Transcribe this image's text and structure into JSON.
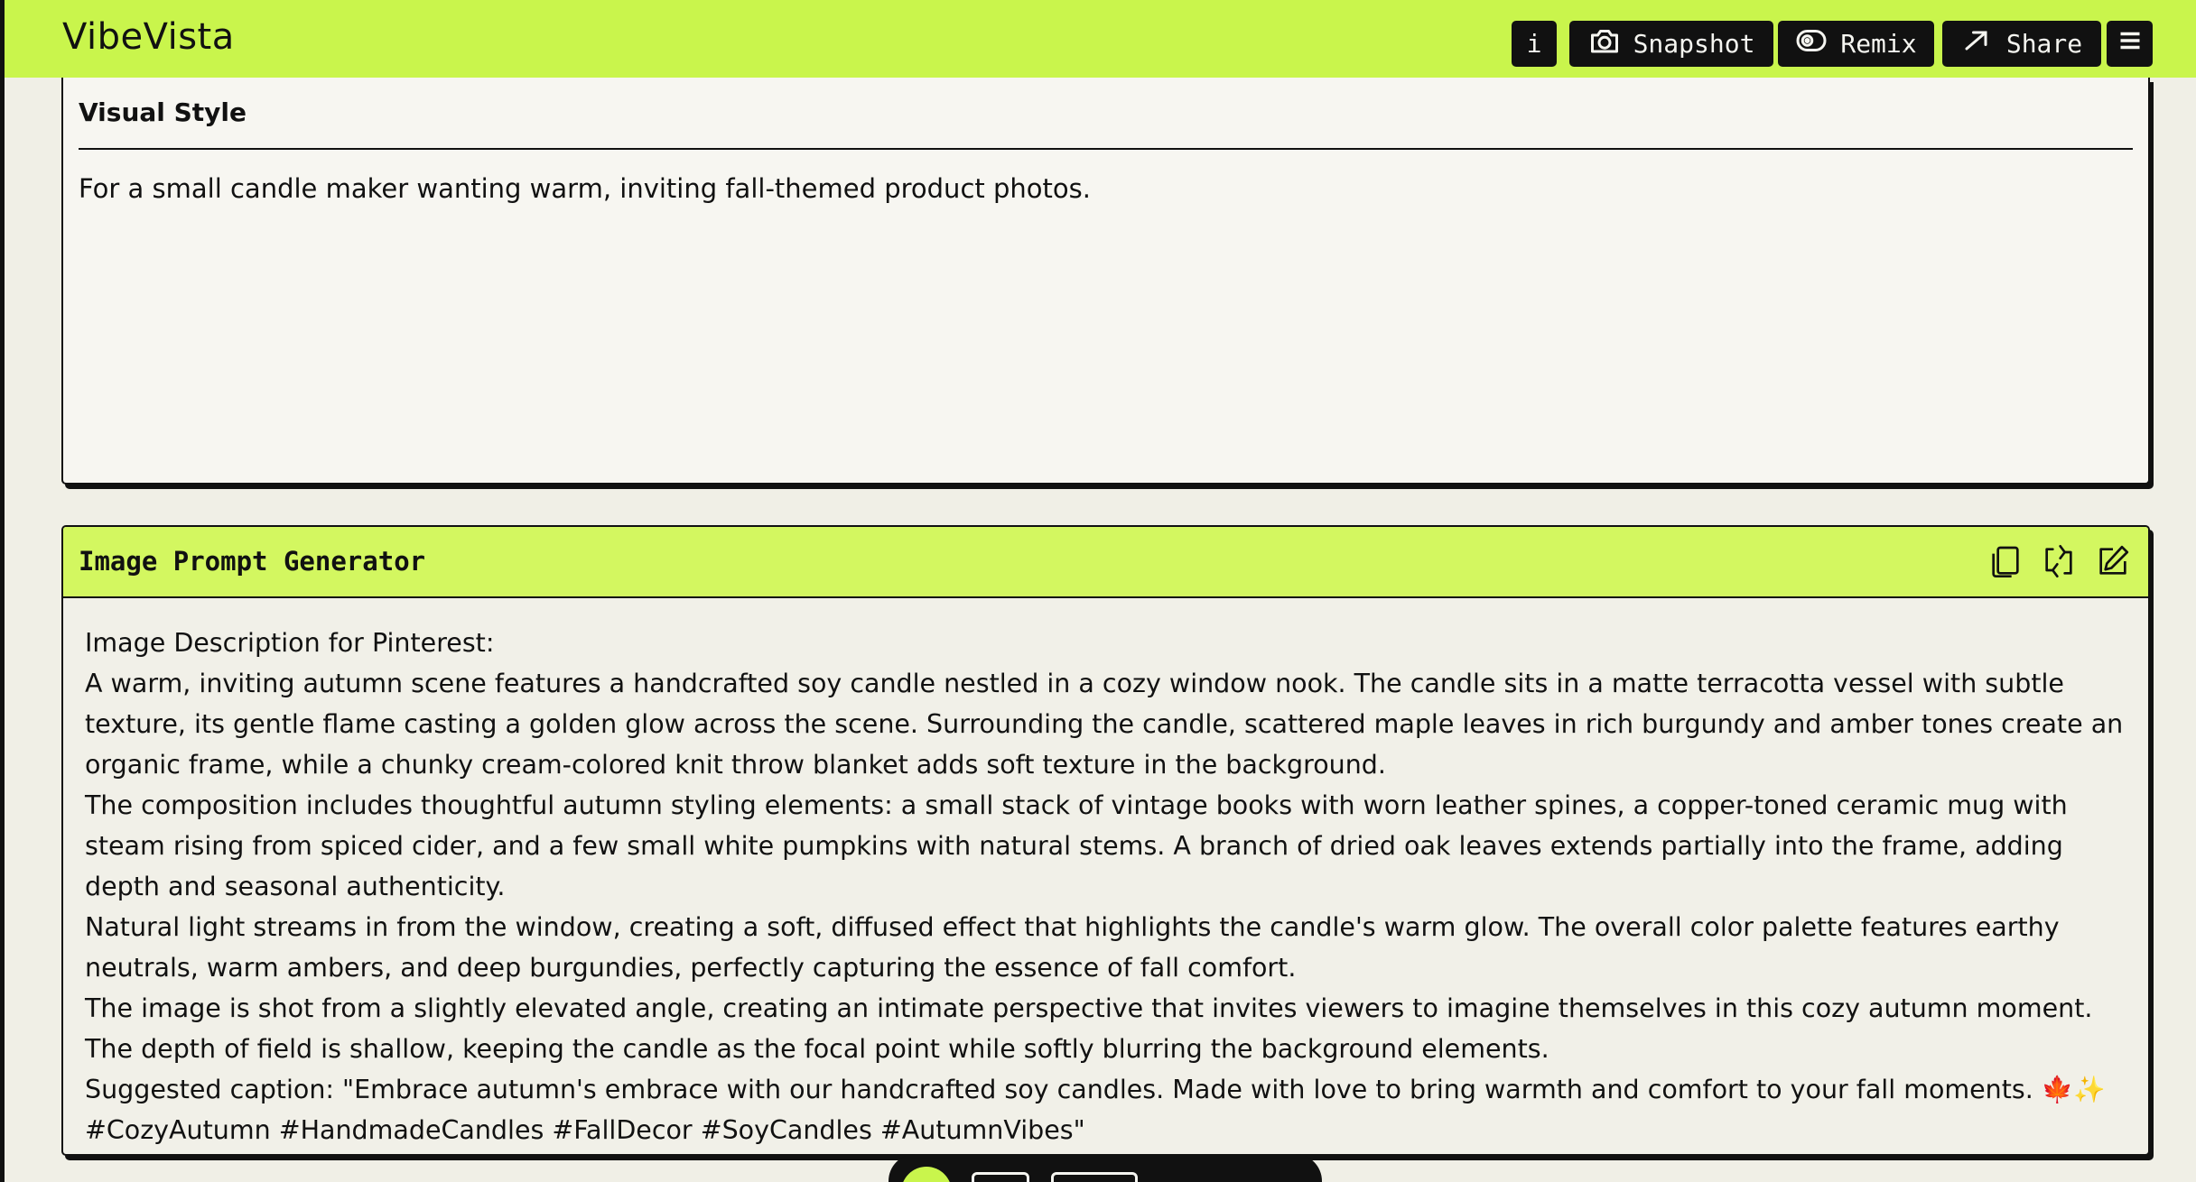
{
  "app": {
    "title": "VibeVista"
  },
  "toolbar": {
    "info_label": "i",
    "snapshot_label": "Snapshot",
    "remix_label": "Remix",
    "share_label": "Share"
  },
  "visual_style": {
    "title": "Visual Style",
    "text": "For a small candle maker wanting warm, inviting fall-themed product photos."
  },
  "generator": {
    "title": "Image Prompt Generator",
    "paragraphs": [
      "Image Description for Pinterest:",
      "A warm, inviting autumn scene features a handcrafted soy candle nestled in a cozy window nook. The candle sits in a matte terracotta vessel with subtle texture, its gentle flame casting a golden glow across the scene. Surrounding the candle, scattered maple leaves in rich burgundy and amber tones create an organic frame, while a chunky cream-colored knit throw blanket adds soft texture in the background.",
      "The composition includes thoughtful autumn styling elements: a small stack of vintage books with worn leather spines, a copper-toned ceramic mug with steam rising from spiced cider, and a few small white pumpkins with natural stems. A branch of dried oak leaves extends partially into the frame, adding depth and seasonal authenticity.",
      "Natural light streams in from the window, creating a soft, diffused effect that highlights the candle's warm glow. The overall color palette features earthy neutrals, warm ambers, and deep burgundies, perfectly capturing the essence of fall comfort.",
      "The image is shot from a slightly elevated angle, creating an intimate perspective that invites viewers to imagine themselves in this cozy autumn moment. The depth of field is shallow, keeping the candle as the focal point while softly blurring the background elements.",
      "Suggested caption: \"Embrace autumn's embrace with our handcrafted soy candles. Made with love to bring warmth and comfort to your fall moments. 🍁✨ #CozyAutumn #HandmadeCandles #FallDecor #SoyCandles #AutumnVibes\""
    ]
  },
  "icons": {
    "info": "info-icon",
    "snapshot": "camera-icon",
    "remix": "remix-icon",
    "share": "share-arrow-icon",
    "menu": "hamburger-menu-icon",
    "copy": "copy-icon",
    "regenerate": "regenerate-icon",
    "edit": "edit-icon"
  },
  "colors": {
    "accent": "#c9f54c",
    "header_accent": "#d3f760",
    "dark": "#111111",
    "background": "#f0efe6"
  }
}
